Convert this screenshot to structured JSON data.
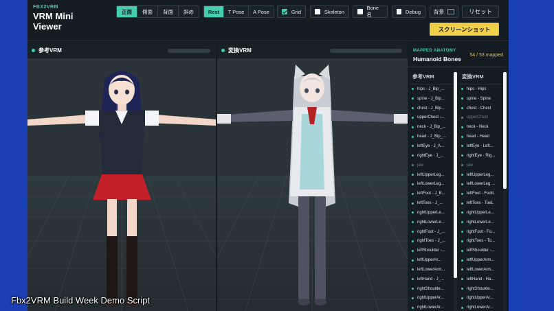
{
  "header": {
    "brand_tag": "FBX2VRM",
    "title": "VRM Mini Viewer",
    "view_buttons": [
      "正面",
      "側面",
      "背面",
      "斜め"
    ],
    "active_view": 0,
    "pose_buttons": [
      "Rest",
      "T Pose",
      "A Pose"
    ],
    "active_pose": 0,
    "grid": {
      "label": "Grid",
      "checked": true
    },
    "skeleton": {
      "label": "Skeleton",
      "checked": false
    },
    "bone_name": {
      "label": "Bone名",
      "checked": false
    },
    "debug": {
      "label": "Debug",
      "checked": false
    },
    "background_label": "背景",
    "reset_label": "リセット",
    "screenshot_label": "スクリーンショット"
  },
  "viewports": {
    "reference": {
      "title": "参考VRM"
    },
    "converted": {
      "title": "変換VRM"
    }
  },
  "panel": {
    "subtitle": "MAPPED ANATOMY",
    "title": "Humanoid Bones",
    "count": "54 / 53 mapped",
    "ref_header": "参考VRM",
    "conv_header": "変換VRM",
    "ref_bones": [
      "hips - J_Bip_...",
      "spine - J_Bip...",
      "chest - J_Bip...",
      "upperChest -...",
      "neck - J_Bip_...",
      "head - J_Bip_...",
      "leftEye - J_A...",
      "rightEye - J_...",
      "jaw",
      "leftUpperLeg...",
      "leftLowerLeg...",
      "leftFoot - J_B...",
      "leftToes - J_...",
      "rightUpperLe...",
      "rightLowerLe...",
      "rightFoot - J_...",
      "rightToes - J_...",
      "leftShoulder -...",
      "leftUpperAr...",
      "leftLowerArm...",
      "leftHand - J_...",
      "rightShoulde...",
      "rightUpperAr...",
      "rightLowerAr..."
    ],
    "conv_bones": [
      "hips - Hips",
      "spine - Spine",
      "chest - Chest",
      "upperChest",
      "neck - Neck",
      "head - Head",
      "leftEye - Left...",
      "rightEye - Rig...",
      "jaw",
      "leftUpperLeg...",
      "leftLowerLeg ...",
      "leftFoot - FootL",
      "leftToes - ToeL",
      "rightUpperLe...",
      "rightLowerLe...",
      "rightFoot - Fo...",
      "rightToes - To...",
      "leftShoulder -...",
      "leftUpperArm...",
      "leftLowerArm...",
      "leftHand - Ha...",
      "rightShoulde...",
      "rightUpperAr...",
      "rightLowerAr..."
    ],
    "ref_unmapped": [
      8
    ],
    "conv_unmapped": [
      3,
      8
    ]
  },
  "caption": "Fbx2VRM Build Week Demo Script",
  "colors": {
    "accent": "#46cdb0",
    "screenshot_button": "#f0cf4a",
    "page_background": "#1b3fb4",
    "viewport_background": "#2a3438"
  }
}
